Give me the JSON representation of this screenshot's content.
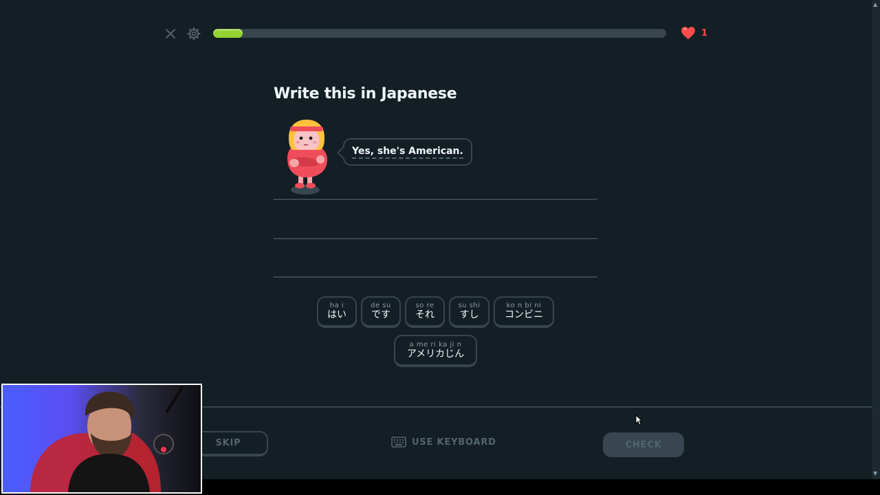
{
  "header": {
    "progress_percent": 6.5,
    "hearts_count": "1"
  },
  "prompt": {
    "title": "Write this in Japanese",
    "speech": "Yes, she's American."
  },
  "word_bank": [
    {
      "ruby": "ha i",
      "kana": "はい"
    },
    {
      "ruby": "de su",
      "kana": "です"
    },
    {
      "ruby": "so re",
      "kana": "それ"
    },
    {
      "ruby": "su shi",
      "kana": "すし"
    },
    {
      "ruby": "ko n bi ni",
      "kana": "コンビニ"
    },
    {
      "ruby": "a me ri ka ji n",
      "kana": "アメリカじん"
    }
  ],
  "footer": {
    "skip_label": "SKIP",
    "keyboard_label": "USE KEYBOARD",
    "check_label": "CHECK"
  },
  "colors": {
    "background": "#131f24",
    "progress": "#93d333",
    "heart": "#ff4b4b",
    "border": "#37464f"
  }
}
